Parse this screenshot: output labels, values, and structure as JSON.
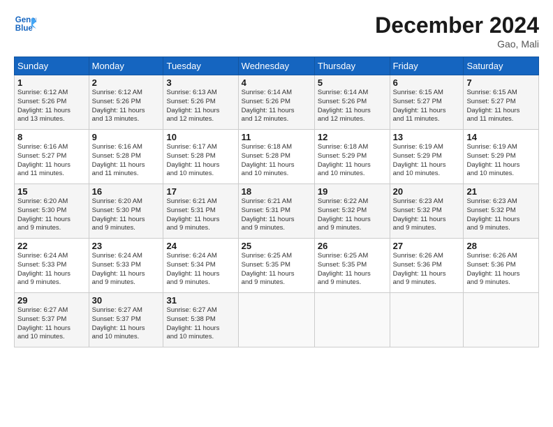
{
  "header": {
    "logo_line1": "General",
    "logo_line2": "Blue",
    "month": "December 2024",
    "location": "Gao, Mali"
  },
  "weekdays": [
    "Sunday",
    "Monday",
    "Tuesday",
    "Wednesday",
    "Thursday",
    "Friday",
    "Saturday"
  ],
  "weeks": [
    [
      {
        "day": "1",
        "info": "Sunrise: 6:12 AM\nSunset: 5:26 PM\nDaylight: 11 hours\nand 13 minutes."
      },
      {
        "day": "2",
        "info": "Sunrise: 6:12 AM\nSunset: 5:26 PM\nDaylight: 11 hours\nand 13 minutes."
      },
      {
        "day": "3",
        "info": "Sunrise: 6:13 AM\nSunset: 5:26 PM\nDaylight: 11 hours\nand 12 minutes."
      },
      {
        "day": "4",
        "info": "Sunrise: 6:14 AM\nSunset: 5:26 PM\nDaylight: 11 hours\nand 12 minutes."
      },
      {
        "day": "5",
        "info": "Sunrise: 6:14 AM\nSunset: 5:26 PM\nDaylight: 11 hours\nand 12 minutes."
      },
      {
        "day": "6",
        "info": "Sunrise: 6:15 AM\nSunset: 5:27 PM\nDaylight: 11 hours\nand 11 minutes."
      },
      {
        "day": "7",
        "info": "Sunrise: 6:15 AM\nSunset: 5:27 PM\nDaylight: 11 hours\nand 11 minutes."
      }
    ],
    [
      {
        "day": "8",
        "info": "Sunrise: 6:16 AM\nSunset: 5:27 PM\nDaylight: 11 hours\nand 11 minutes."
      },
      {
        "day": "9",
        "info": "Sunrise: 6:16 AM\nSunset: 5:28 PM\nDaylight: 11 hours\nand 11 minutes."
      },
      {
        "day": "10",
        "info": "Sunrise: 6:17 AM\nSunset: 5:28 PM\nDaylight: 11 hours\nand 10 minutes."
      },
      {
        "day": "11",
        "info": "Sunrise: 6:18 AM\nSunset: 5:28 PM\nDaylight: 11 hours\nand 10 minutes."
      },
      {
        "day": "12",
        "info": "Sunrise: 6:18 AM\nSunset: 5:29 PM\nDaylight: 11 hours\nand 10 minutes."
      },
      {
        "day": "13",
        "info": "Sunrise: 6:19 AM\nSunset: 5:29 PM\nDaylight: 11 hours\nand 10 minutes."
      },
      {
        "day": "14",
        "info": "Sunrise: 6:19 AM\nSunset: 5:29 PM\nDaylight: 11 hours\nand 10 minutes."
      }
    ],
    [
      {
        "day": "15",
        "info": "Sunrise: 6:20 AM\nSunset: 5:30 PM\nDaylight: 11 hours\nand 9 minutes."
      },
      {
        "day": "16",
        "info": "Sunrise: 6:20 AM\nSunset: 5:30 PM\nDaylight: 11 hours\nand 9 minutes."
      },
      {
        "day": "17",
        "info": "Sunrise: 6:21 AM\nSunset: 5:31 PM\nDaylight: 11 hours\nand 9 minutes."
      },
      {
        "day": "18",
        "info": "Sunrise: 6:21 AM\nSunset: 5:31 PM\nDaylight: 11 hours\nand 9 minutes."
      },
      {
        "day": "19",
        "info": "Sunrise: 6:22 AM\nSunset: 5:32 PM\nDaylight: 11 hours\nand 9 minutes."
      },
      {
        "day": "20",
        "info": "Sunrise: 6:23 AM\nSunset: 5:32 PM\nDaylight: 11 hours\nand 9 minutes."
      },
      {
        "day": "21",
        "info": "Sunrise: 6:23 AM\nSunset: 5:32 PM\nDaylight: 11 hours\nand 9 minutes."
      }
    ],
    [
      {
        "day": "22",
        "info": "Sunrise: 6:24 AM\nSunset: 5:33 PM\nDaylight: 11 hours\nand 9 minutes."
      },
      {
        "day": "23",
        "info": "Sunrise: 6:24 AM\nSunset: 5:33 PM\nDaylight: 11 hours\nand 9 minutes."
      },
      {
        "day": "24",
        "info": "Sunrise: 6:24 AM\nSunset: 5:34 PM\nDaylight: 11 hours\nand 9 minutes."
      },
      {
        "day": "25",
        "info": "Sunrise: 6:25 AM\nSunset: 5:35 PM\nDaylight: 11 hours\nand 9 minutes."
      },
      {
        "day": "26",
        "info": "Sunrise: 6:25 AM\nSunset: 5:35 PM\nDaylight: 11 hours\nand 9 minutes."
      },
      {
        "day": "27",
        "info": "Sunrise: 6:26 AM\nSunset: 5:36 PM\nDaylight: 11 hours\nand 9 minutes."
      },
      {
        "day": "28",
        "info": "Sunrise: 6:26 AM\nSunset: 5:36 PM\nDaylight: 11 hours\nand 9 minutes."
      }
    ],
    [
      {
        "day": "29",
        "info": "Sunrise: 6:27 AM\nSunset: 5:37 PM\nDaylight: 11 hours\nand 10 minutes."
      },
      {
        "day": "30",
        "info": "Sunrise: 6:27 AM\nSunset: 5:37 PM\nDaylight: 11 hours\nand 10 minutes."
      },
      {
        "day": "31",
        "info": "Sunrise: 6:27 AM\nSunset: 5:38 PM\nDaylight: 11 hours\nand 10 minutes."
      },
      {
        "day": "",
        "info": ""
      },
      {
        "day": "",
        "info": ""
      },
      {
        "day": "",
        "info": ""
      },
      {
        "day": "",
        "info": ""
      }
    ]
  ]
}
